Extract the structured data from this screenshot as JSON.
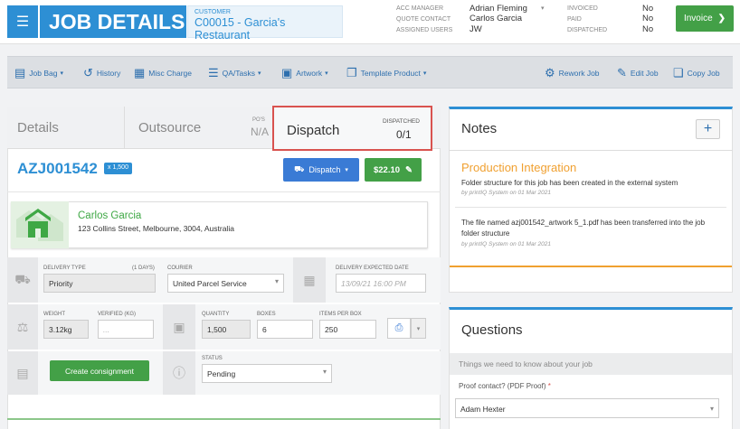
{
  "header": {
    "title": "JOB DETAILS",
    "customer_label": "CUSTOMER",
    "customer_name": "C00015 - Garcia's Restaurant",
    "acc_manager_label": "ACC MANAGER",
    "acc_manager": "Adrian Fleming",
    "quote_contact_label": "QUOTE CONTACT",
    "quote_contact": "Carlos Garcia",
    "assigned_users_label": "ASSIGNED USERS",
    "assigned_users": "JW",
    "invoiced_label": "INVOICED",
    "invoiced": "No",
    "paid_label": "PAID",
    "paid": "No",
    "dispatched_label": "DISPATCHED",
    "dispatched": "No",
    "invoice_button": "Invoice"
  },
  "toolbar": {
    "job_bag": "Job Bag",
    "history": "History",
    "misc_charge": "Misc Charge",
    "qa_tasks": "QA/Tasks",
    "artwork": "Artwork",
    "template_product": "Template Product",
    "rework_job": "Rework Job",
    "edit_job": "Edit Job",
    "copy_job": "Copy Job"
  },
  "tabs": {
    "details": "Details",
    "outsource": "Outsource",
    "pos_label": "PO'S",
    "pos_value": "N/A",
    "dispatch": "Dispatch",
    "dispatched_label": "DISPATCHED",
    "dispatched_value": "0/1"
  },
  "job": {
    "number": "AZJ001542",
    "qty_badge": "x 1,500",
    "dispatch_button": "Dispatch",
    "price_button": "$22.10"
  },
  "address": {
    "name": "Carlos Garcia",
    "line": "123 Collins Street, Melbourne, 3004, Australia"
  },
  "delivery": {
    "type_label": "DELIVERY TYPE",
    "days_label": "(1 DAYS)",
    "type_value": "Priority",
    "courier_label": "COURIER",
    "courier_value": "United Parcel Service",
    "expected_label": "DELIVERY EXPECTED DATE",
    "expected_placeholder": "13/09/21 16:00 PM"
  },
  "weights": {
    "weight_label": "WEIGHT",
    "weight_value": "3.12kg",
    "verified_label": "VERIFIED (KG)",
    "verified_placeholder": "...",
    "quantity_label": "QUANTITY",
    "quantity_value": "1,500",
    "boxes_label": "BOXES",
    "boxes_value": "6",
    "items_label": "ITEMS PER BOX",
    "items_value": "250"
  },
  "consignment": {
    "create_button": "Create consignment",
    "status_label": "STATUS",
    "status_value": "Pending"
  },
  "notes": {
    "title": "Notes",
    "add": "+",
    "note1_title": "Production Integration",
    "note1_body": "Folder structure for this job has been created in the external system",
    "note1_meta": "by printIQ System on 01 Mar 2021",
    "note2_body": "The file named azj001542_artwork 5_1.pdf has been transferred into the job folder structure",
    "note2_meta": "by printIQ System on 01 Mar 2021"
  },
  "questions": {
    "title": "Questions",
    "subtitle": "Things we need to know about your job",
    "proof_label": "Proof contact? (PDF Proof)",
    "required_mark": "*",
    "proof_value": "Adam Hexter"
  },
  "colors": {
    "brand_blue": "#2d8fd4",
    "green": "#43a047",
    "highlight_red": "#d9534f",
    "note_orange": "#f0a030"
  }
}
